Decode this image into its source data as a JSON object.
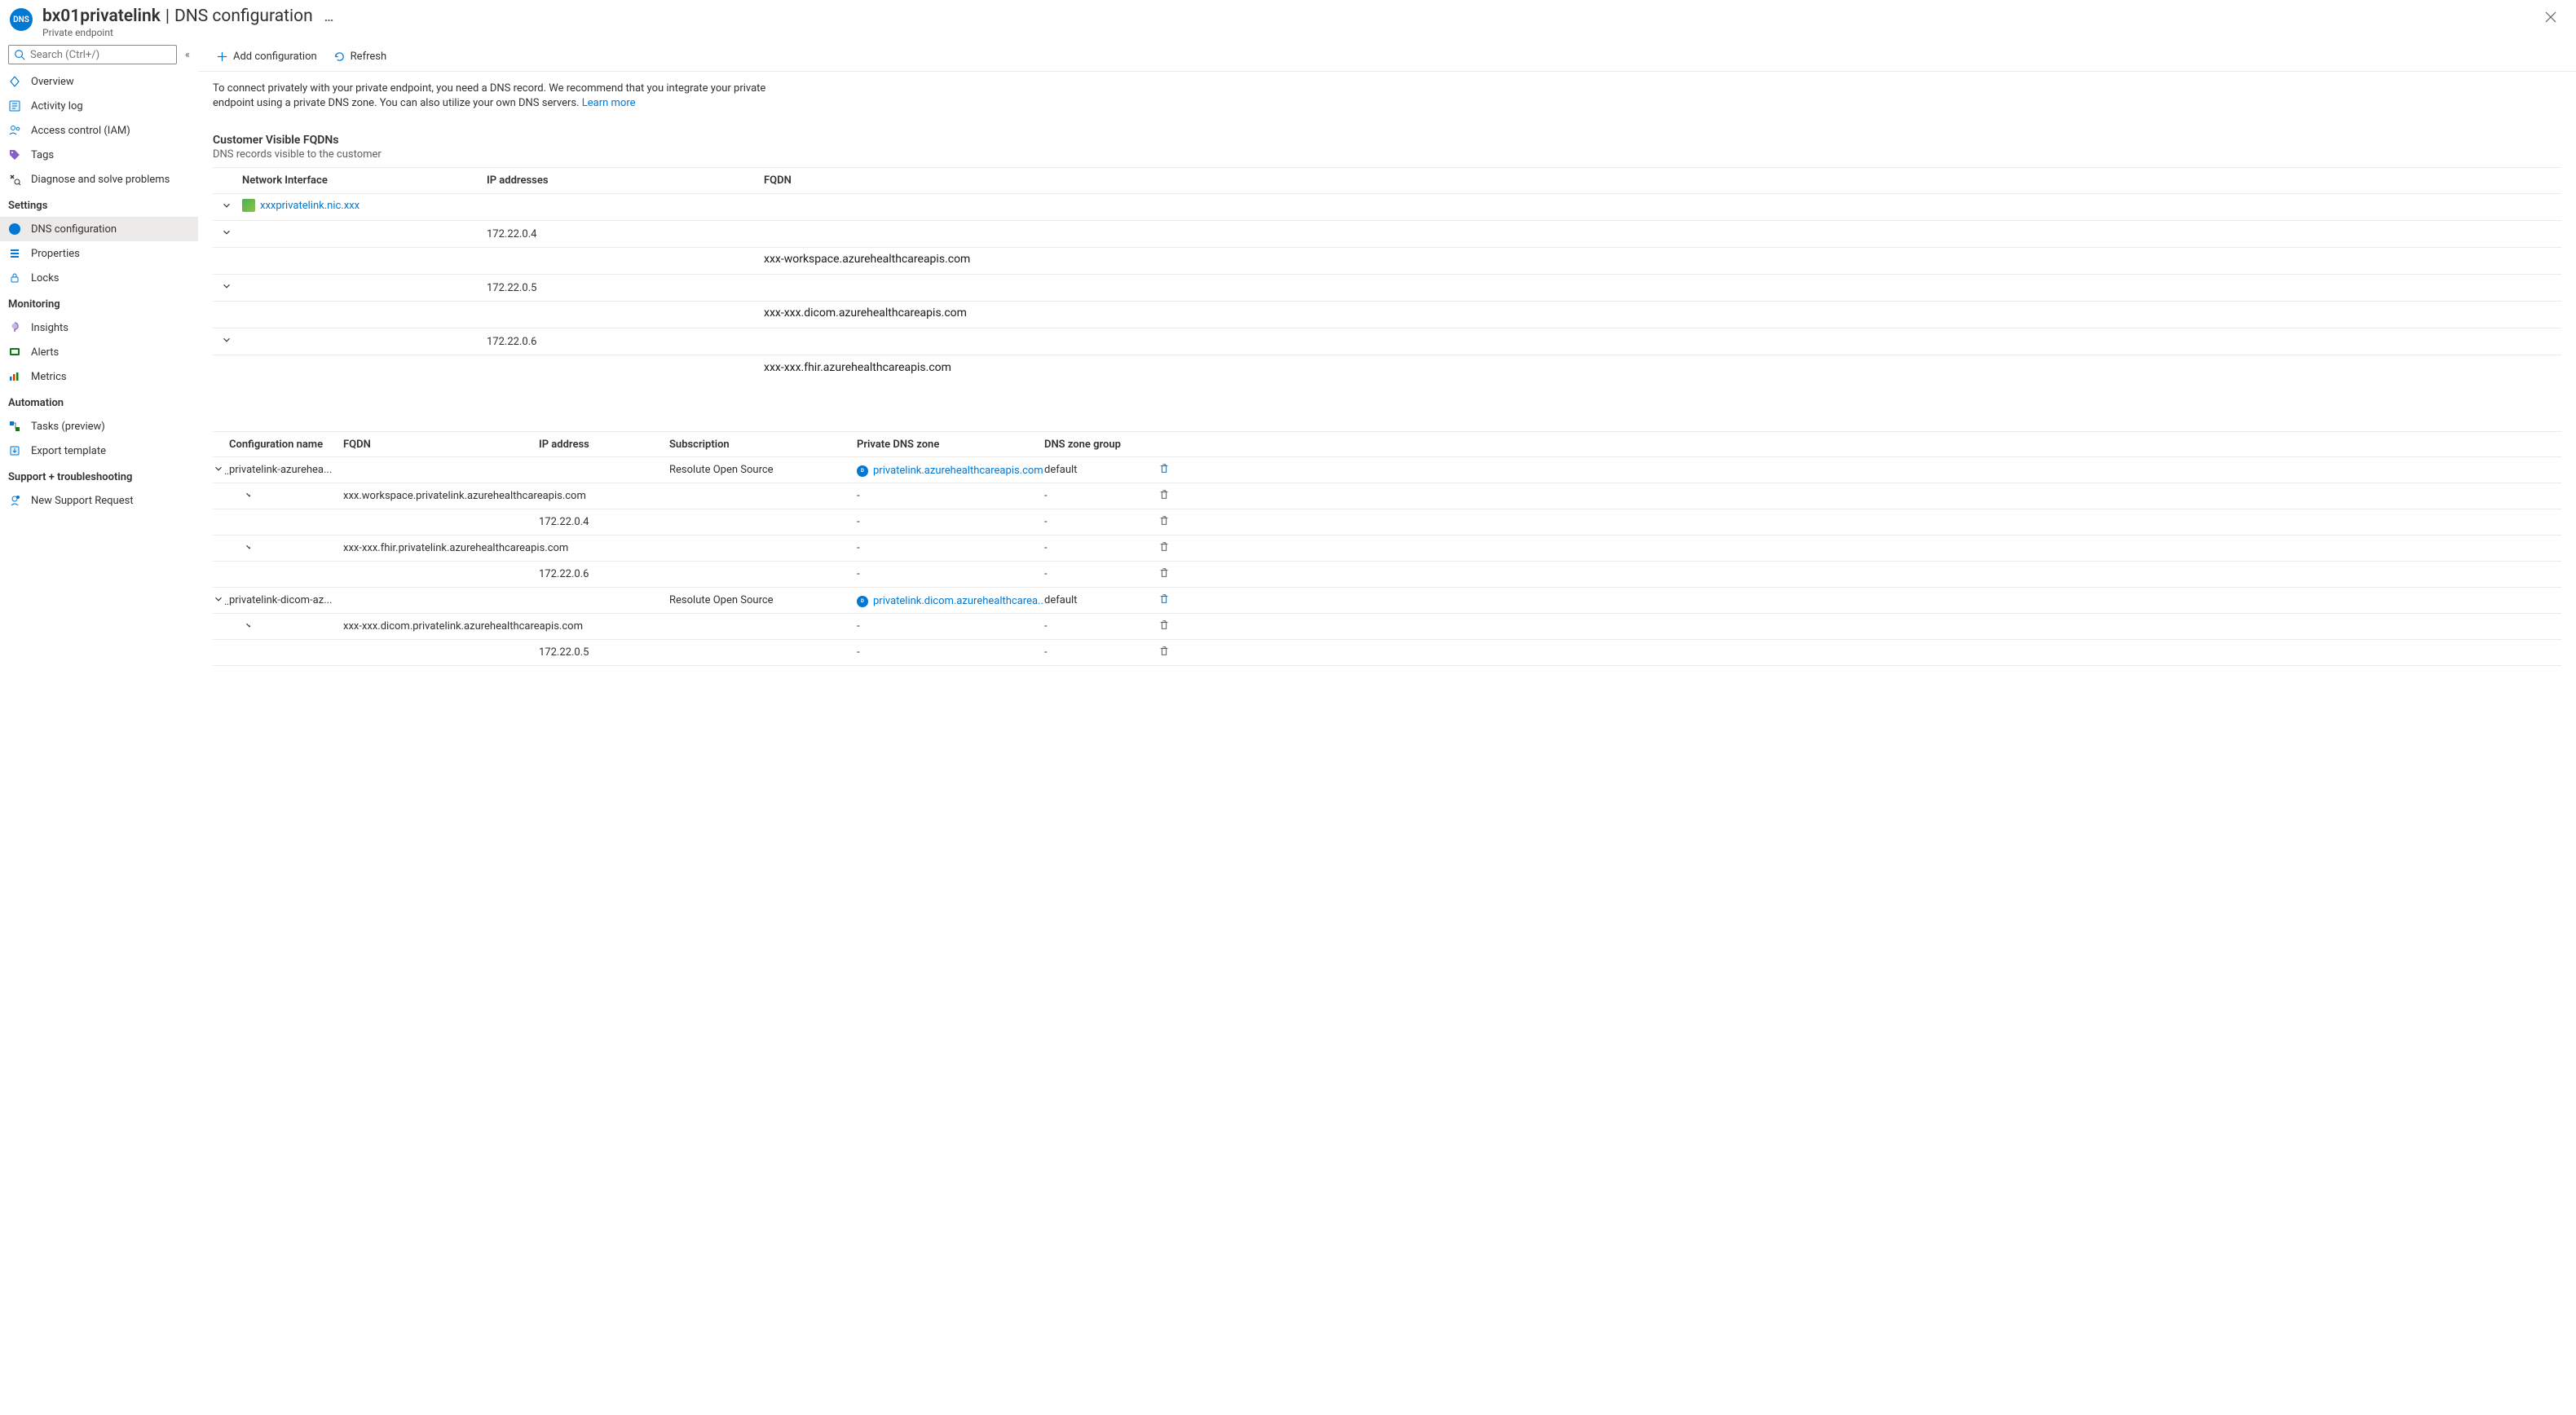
{
  "header": {
    "resource_name": "bx01privatelink",
    "page_title": "DNS configuration",
    "resource_type": "Private endpoint",
    "more": "…",
    "close": "✕"
  },
  "sidebar": {
    "search_placeholder": "Search (Ctrl+/)",
    "collapse": "«",
    "items_top": [
      {
        "label": "Overview",
        "icon": "overview"
      },
      {
        "label": "Activity log",
        "icon": "activity"
      },
      {
        "label": "Access control (IAM)",
        "icon": "iam"
      },
      {
        "label": "Tags",
        "icon": "tags"
      },
      {
        "label": "Diagnose and solve problems",
        "icon": "diagnose"
      }
    ],
    "section_settings": "Settings",
    "items_settings": [
      {
        "label": "DNS configuration",
        "icon": "dns",
        "selected": true
      },
      {
        "label": "Properties",
        "icon": "properties"
      },
      {
        "label": "Locks",
        "icon": "locks"
      }
    ],
    "section_monitoring": "Monitoring",
    "items_monitoring": [
      {
        "label": "Insights",
        "icon": "insights"
      },
      {
        "label": "Alerts",
        "icon": "alerts"
      },
      {
        "label": "Metrics",
        "icon": "metrics"
      }
    ],
    "section_automation": "Automation",
    "items_automation": [
      {
        "label": "Tasks (preview)",
        "icon": "tasks"
      },
      {
        "label": "Export template",
        "icon": "export"
      }
    ],
    "section_support": "Support + troubleshooting",
    "items_support": [
      {
        "label": "New Support Request",
        "icon": "support"
      }
    ]
  },
  "toolbar": {
    "add": "Add configuration",
    "refresh": "Refresh"
  },
  "intro": {
    "text": "To connect privately with your private endpoint, you need a DNS record. We recommend that you integrate your private endpoint using a private DNS zone. You can also utilize your own DNS servers. ",
    "learn_more": "Learn more"
  },
  "fqdn_section": {
    "title": "Customer Visible FQDNs",
    "subtitle": "DNS records visible to the customer",
    "headers": {
      "nic": "Network Interface",
      "ip": "IP addresses",
      "fqdn": "FQDN"
    },
    "nic_link": "xxxprivatelink.nic.xxx",
    "rows": [
      {
        "ip": "172.22.0.4",
        "fqdn": "xxx-workspace.azurehealthcareapis.com"
      },
      {
        "ip": "172.22.0.5",
        "fqdn": "xxx-xxx.dicom.azurehealthcareapis.com"
      },
      {
        "ip": "172.22.0.6",
        "fqdn": "xxx-xxx.fhir.azurehealthcareapis.com"
      }
    ]
  },
  "config_section": {
    "headers": {
      "name": "Configuration name",
      "fqdn": "FQDN",
      "ip": "IP address",
      "sub": "Subscription",
      "zone": "Private DNS zone",
      "group": "DNS zone group"
    },
    "groups": [
      {
        "name": "privatelink-azurehea...",
        "subscription": "Resolute Open Source",
        "zone": "privatelink.azurehealthcareapis.com",
        "group": "default",
        "records": [
          {
            "fqdn": "xxx.workspace.privatelink.azurehealthcareapis.com",
            "ips": [
              "172.22.0.4"
            ]
          },
          {
            "fqdn": "xxx-xxx.fhir.privatelink.azurehealthcareapis.com",
            "ips": [
              "172.22.0.6"
            ]
          }
        ]
      },
      {
        "name": "privatelink-dicom-az...",
        "subscription": "Resolute Open Source",
        "zone": "privatelink.dicom.azurehealthcarea...",
        "group": "default",
        "records": [
          {
            "fqdn": "xxx-xxx.dicom.privatelink.azurehealthcareapis.com",
            "ips": [
              "172.22.0.5"
            ]
          }
        ]
      }
    ]
  },
  "icons": {
    "dash": "-"
  }
}
